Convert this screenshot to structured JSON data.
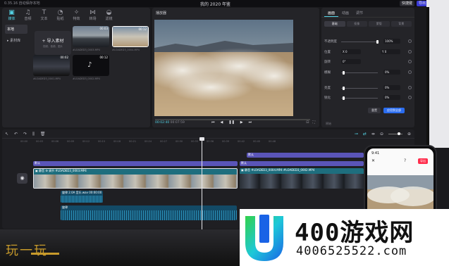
{
  "titlebar": {
    "left_text": "0.35.16 自动保存本地",
    "center_text": "我的 2020 年鉴",
    "shortcut_btn": "快捷键",
    "export_btn": "导出"
  },
  "media": {
    "tools": [
      {
        "label": "媒体",
        "icon": "media-icon"
      },
      {
        "label": "音频",
        "icon": "audio-icon"
      },
      {
        "label": "文本",
        "icon": "text-icon"
      },
      {
        "label": "贴纸",
        "icon": "sticker-icon"
      },
      {
        "label": "特效",
        "icon": "effects-icon"
      },
      {
        "label": "转场",
        "icon": "transition-icon"
      },
      {
        "label": "滤镜",
        "icon": "filter-icon"
      }
    ],
    "nav": [
      "本地",
      "▸ 素材库"
    ],
    "import_label": "+ 导入素材",
    "import_sub": "视频、音频、图片",
    "thumbs": [
      {
        "dur": "00:03",
        "name": "#LOADED3_0003.MP4"
      },
      {
        "dur": "00:12",
        "name": "#LOADED3_0004.MP4"
      },
      {
        "dur": "00:02",
        "name": "#LOADED3_0001.MP4"
      },
      {
        "dur": "00:12",
        "name": "#LOADED3_0002.MP4"
      }
    ]
  },
  "player": {
    "title": "播放器",
    "current": "00:02:40",
    "total": "00:07:59"
  },
  "props": {
    "tabs": [
      "画面",
      "动画",
      "调节"
    ],
    "subtabs": [
      "基础",
      "抠像",
      "蒙版",
      "背景"
    ],
    "rows": [
      {
        "label": "不透明度",
        "value": "100%"
      },
      {
        "label": "位置",
        "x": "X 0",
        "y": "Y 0"
      },
      {
        "label": "旋转",
        "value": "0°"
      },
      {
        "label": "模糊",
        "value": "0%"
      },
      {
        "label": "亮度",
        "value": "0%"
      },
      {
        "label": "锐化",
        "value": "0%"
      }
    ],
    "reset": "重置",
    "apply_all": "应用到全部",
    "footer": "原始"
  },
  "timeline": {
    "ruler": [
      "00:00",
      "00:03",
      "00:06",
      "00:09",
      "00:12",
      "00:15",
      "00:18",
      "00:21",
      "00:24",
      "00:27",
      "00:30",
      "00:33",
      "00:36",
      "00:39",
      "00:42",
      "00:45",
      "00:48"
    ],
    "text_clips": [
      "默认",
      "默认",
      "默认"
    ],
    "video_label_1": "▣ 静音  ⚙ 调节  #LOADED3_0003.MP4",
    "video_label_2": "▣ 静音  #LOADED3_0004.MP4  #LOADED3_0002.MP4",
    "audio_label_1": "旋律 2.0A  音乐.wav  00:00:00",
    "audio_label_2": "旋律",
    "cover": "封面"
  },
  "phone": {
    "time": "9:41",
    "export": "导出"
  },
  "dock": {
    "logo": "玩一玩"
  },
  "banner": {
    "brand": "400游戏网",
    "phone": "4006525522.com"
  },
  "colors": {
    "accent": "#54d3e6",
    "primary": "#2b6df0",
    "text_track": "#5a55b8",
    "video_track": "#1e6e7e",
    "audio_track": "#134a66",
    "audio_wave": "#2a8fb8"
  }
}
